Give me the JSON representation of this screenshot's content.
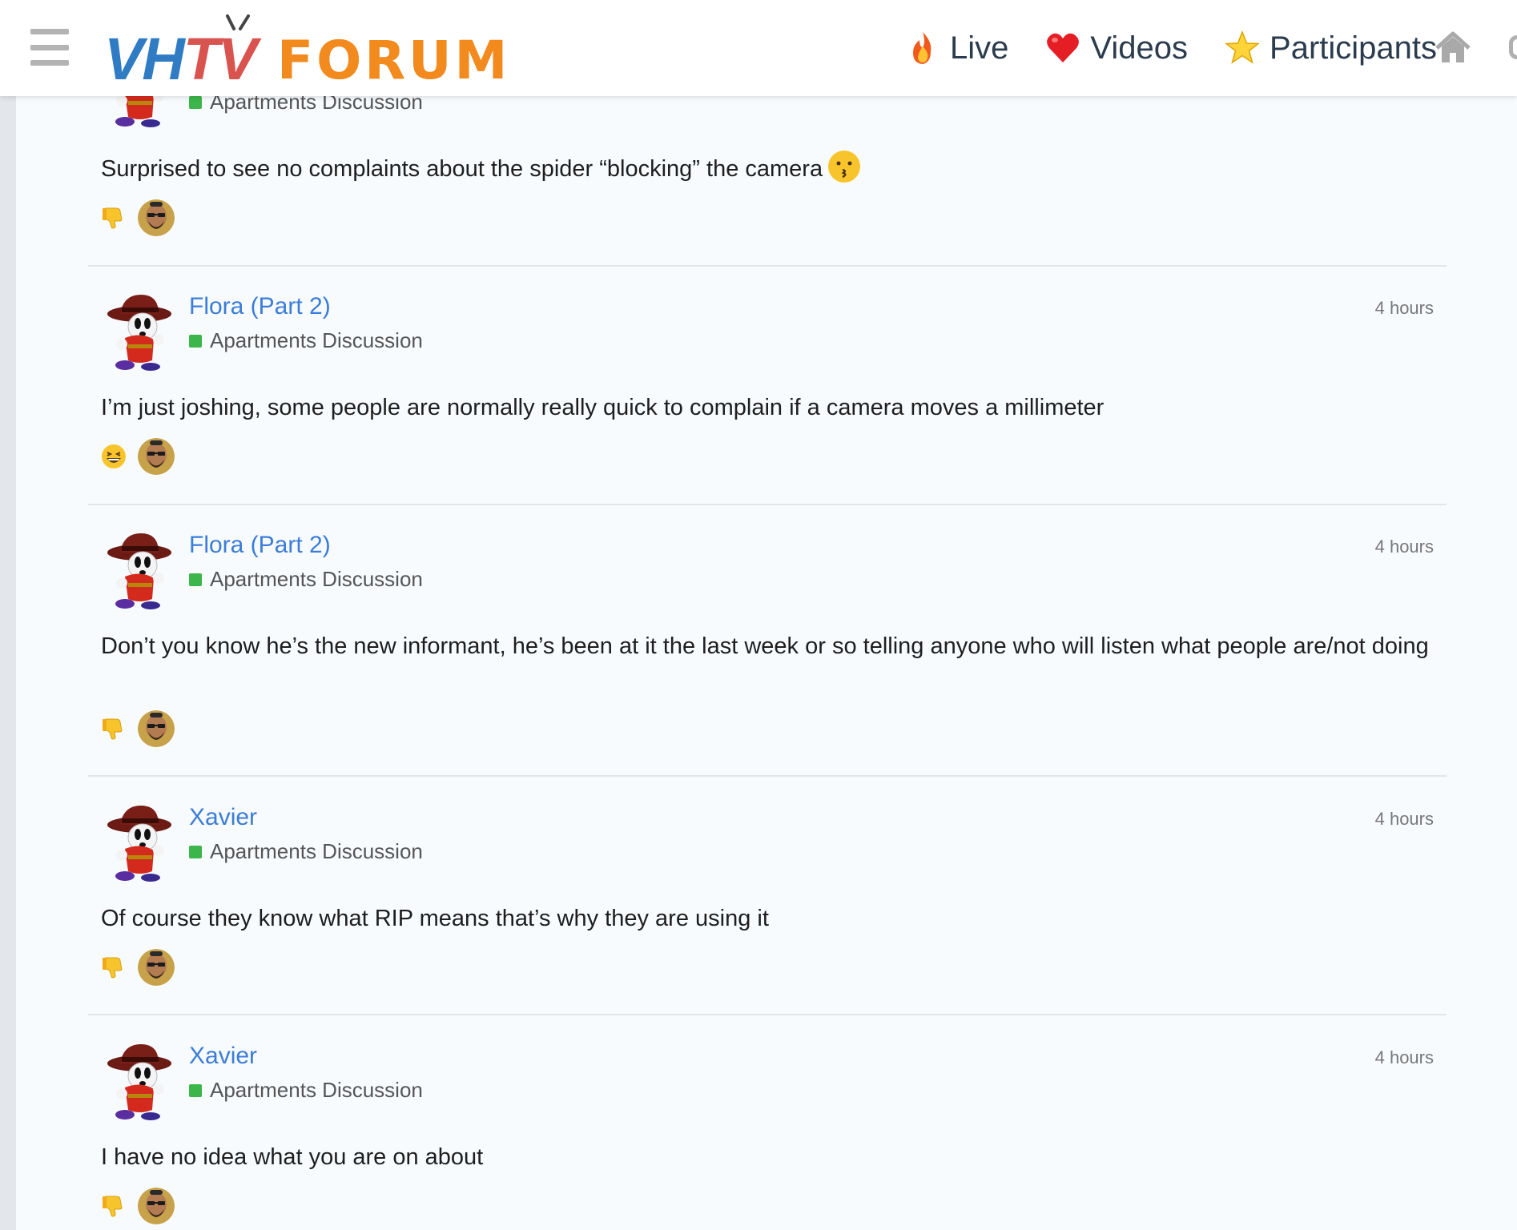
{
  "header": {
    "logo_left_blue": "VH",
    "logo_left_red": "TV",
    "logo_right": "FORUM",
    "nav": [
      {
        "label": "Live",
        "icon": "fire-icon"
      },
      {
        "label": "Videos",
        "icon": "heart-icon"
      },
      {
        "label": "Participants",
        "icon": "star-icon"
      }
    ],
    "home_icon": "home-icon",
    "menu_icon": "hamburger-menu-icon"
  },
  "colors": {
    "link": "#3b7dd8",
    "category_dot": "#3cb64a",
    "logo_blue": "#2f7bc4",
    "logo_red": "#d9534f",
    "logo_orange": "#f28a1e"
  },
  "posts": [
    {
      "author": "",
      "category": "Apartments Discussion",
      "time": "",
      "text": "Surprised to see no complaints about the spider “blocking” the camera",
      "inline_emoji": "kissing-face-icon",
      "reaction": "thumbs-down-icon"
    },
    {
      "author": "Flora (Part 2)",
      "category": "Apartments Discussion",
      "time": "4 hours",
      "text": "I’m just joshing, some people are normally really quick to complain if a camera moves a millimeter",
      "reaction": "laughing-face-icon"
    },
    {
      "author": "Flora (Part 2)",
      "category": "Apartments Discussion",
      "time": "4 hours",
      "text": "Don’t you know he’s the new informant, he’s been at it the last week or so telling anyone who will listen what people are/not doing",
      "reaction": "thumbs-down-icon"
    },
    {
      "author": "Xavier",
      "category": "Apartments Discussion",
      "time": "4 hours",
      "text": "Of course they know what RIP means that’s why they are using it",
      "reaction": "thumbs-down-icon"
    },
    {
      "author": "Xavier",
      "category": "Apartments Discussion",
      "time": "4 hours",
      "text": "I have no idea what you are on about",
      "reaction": "thumbs-down-icon"
    }
  ]
}
